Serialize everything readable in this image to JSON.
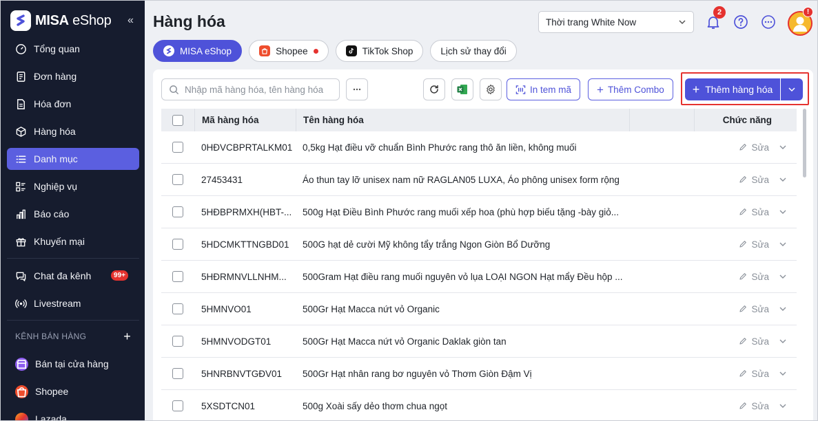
{
  "brand": {
    "name_bold": "MISA",
    "name_rest": "eShop",
    "collapse": "«"
  },
  "sidebar": {
    "items": [
      {
        "label": "Tổng quan",
        "icon": "speedometer-icon"
      },
      {
        "label": "Đơn hàng",
        "icon": "receipt-icon"
      },
      {
        "label": "Hóa đơn",
        "icon": "invoice-icon"
      },
      {
        "label": "Hàng hóa",
        "icon": "box-icon"
      },
      {
        "label": "Danh mục",
        "icon": "list-icon",
        "active": true
      },
      {
        "label": "Nghiệp vụ",
        "icon": "tasks-icon"
      },
      {
        "label": "Báo cáo",
        "icon": "bar-chart-icon"
      },
      {
        "label": "Khuyến mại",
        "icon": "gift-icon"
      }
    ],
    "chat": {
      "label": "Chat đa kênh",
      "badge": "99+"
    },
    "livestream": {
      "label": "Livestream"
    },
    "section_title": "KÊNH BÁN HÀNG",
    "section_plus": "+",
    "channels": [
      {
        "label": "Bán tại cửa hàng"
      },
      {
        "label": "Shopee"
      },
      {
        "label": "Lazada"
      }
    ]
  },
  "header": {
    "title": "Hàng hóa",
    "store": "Thời trang White Now",
    "notifications": "2",
    "avatar_alert": "!"
  },
  "tabs": [
    {
      "label": "MISA eShop"
    },
    {
      "label": "Shopee"
    },
    {
      "label": "TikTok Shop"
    },
    {
      "label": "Lịch sử thay đổi"
    }
  ],
  "toolbar": {
    "search_placeholder": "Nhập mã hàng hóa, tên hàng hóa",
    "print_label": "In tem mã",
    "combo_label": "Thêm Combo",
    "add_label": "Thêm hàng hóa"
  },
  "table": {
    "columns": {
      "code": "Mã hàng hóa",
      "name": "Tên hàng hóa",
      "actions": "Chức năng"
    },
    "edit_label": "Sửa",
    "rows": [
      {
        "code": "0HĐVCBPRTALKM01",
        "name": "0,5kg Hạt điều vỡ chuẩn Bình Phước rang thô ăn liền, không muối"
      },
      {
        "code": "27453431",
        "name": "Áo thun tay lỡ unisex nam nữ RAGLAN05 LUXA, Áo phông unisex form rộng"
      },
      {
        "code": "5HĐBPRMXH(HBT-...",
        "name": "500g Hạt Điều Bình Phước rang muối xếp hoa (phù hợp biếu tặng -bày giỏ..."
      },
      {
        "code": "5HDCMKTTNGBD01",
        "name": "500G hạt dẻ cười Mỹ không tẩy trắng Ngon Giòn Bổ Dưỡng"
      },
      {
        "code": "5HĐRMNVLLNHM...",
        "name": "500Gram Hạt điều rang muối nguyên vỏ lụa LOẠI NGON Hạt mẩy Đều hộp ..."
      },
      {
        "code": "5HMNVO01",
        "name": "500Gr Hạt Macca nứt vỏ Organic"
      },
      {
        "code": "5HMNVODGT01",
        "name": "500Gr Hạt Macca nứt vỏ Organic Daklak giòn tan"
      },
      {
        "code": "5HNRBNVTGĐV01",
        "name": "500Gr Hạt nhân rang bơ nguyên vỏ Thơm Giòn Đậm Vị"
      },
      {
        "code": "5XSDTCN01",
        "name": "500g Xoài sấy dẻo thơm chua ngọt"
      }
    ]
  },
  "colors": {
    "sidebar": "#161c2e",
    "accent": "#4e52d9",
    "alert": "#e5322f"
  }
}
